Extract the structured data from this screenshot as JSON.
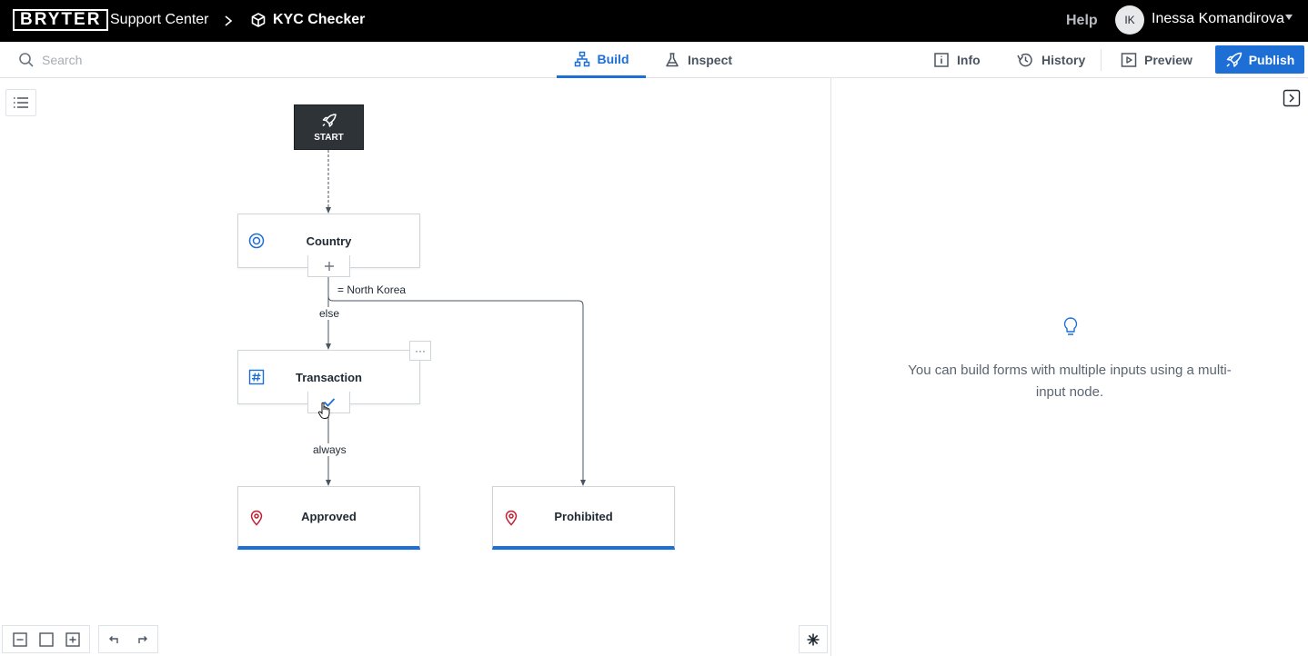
{
  "app": {
    "logo": "BRYTER",
    "breadcrumb_root": "Support Center",
    "breadcrumb_current": "KYC Checker",
    "help_label": "Help",
    "user_initials": "IK",
    "user_name": "Inessa Komandirova"
  },
  "toolbar": {
    "search_placeholder": "Search",
    "tabs": [
      {
        "label": "Build",
        "active": true
      },
      {
        "label": "Inspect",
        "active": false
      }
    ],
    "info_label": "Info",
    "history_label": "History",
    "preview_label": "Preview",
    "publish_label": "Publish"
  },
  "flow": {
    "start_label": "START",
    "nodes": [
      {
        "label": "Country",
        "icon": "radio-target-icon"
      },
      {
        "label": "Transaction",
        "icon": "hash-icon"
      },
      {
        "label": "Approved",
        "icon": "map-pin-icon"
      },
      {
        "label": "Prohibited",
        "icon": "map-pin-icon"
      }
    ],
    "edges": {
      "north_korea": "= North Korea",
      "else": "else",
      "always": "always"
    },
    "more_label": "···"
  },
  "panel": {
    "tip_text": "You can build forms with multiple inputs using a multi-input node."
  },
  "colors": {
    "accent": "#1d6fd6",
    "topbar": "#000000",
    "start_node": "#2e3338",
    "pin": "#c21f32"
  }
}
